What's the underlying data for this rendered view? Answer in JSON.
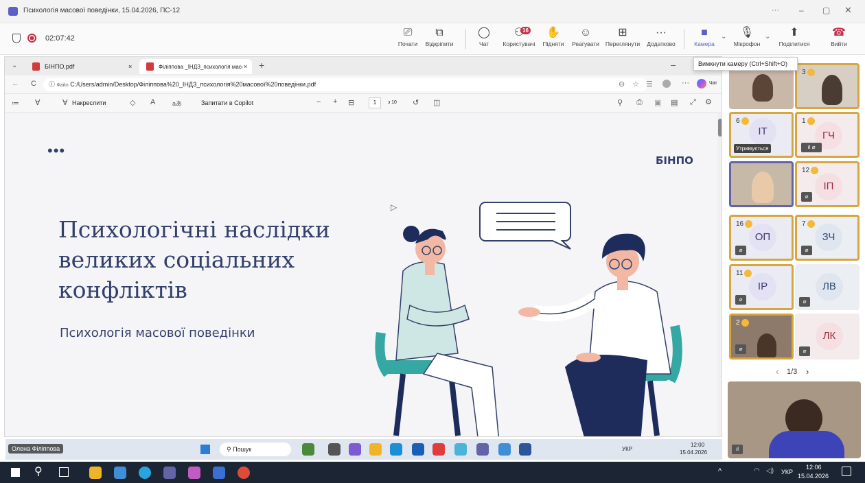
{
  "window": {
    "title": "Психологія масової поведінки, 15.04.2026, ПС-12",
    "controls": [
      "···",
      "–",
      "▢",
      "✕"
    ]
  },
  "meeting": {
    "timer": "02:07:42",
    "buttons": [
      {
        "id": "present",
        "label": "Почати",
        "icon": "present-icon"
      },
      {
        "id": "popout",
        "label": "Відкріпити",
        "icon": "popout-icon"
      },
      {
        "id": "chat",
        "label": "Чат",
        "icon": "chat-icon"
      },
      {
        "id": "people",
        "label": "Користувачі",
        "icon": "people-icon",
        "badge": "16"
      },
      {
        "id": "raise",
        "label": "Підняти",
        "icon": "raise-hand-icon"
      },
      {
        "id": "react",
        "label": "Реагувати",
        "icon": "react-icon"
      },
      {
        "id": "view",
        "label": "Переглянути",
        "icon": "view-icon"
      },
      {
        "id": "more",
        "label": "Додатково",
        "icon": "more-icon"
      },
      {
        "id": "camera",
        "label": "Камера",
        "icon": "camera-icon"
      },
      {
        "id": "mic",
        "label": "Мікрофон",
        "icon": "mic-off-icon"
      },
      {
        "id": "share",
        "label": "Поділитися",
        "icon": "share-icon"
      },
      {
        "id": "leave",
        "label": "Вийти",
        "icon": "leave-icon"
      }
    ],
    "tooltip": "Вимкнути камеру (Ctrl+Shift+O)",
    "pager": "1/3",
    "presenter_name": "Олена Філіппова"
  },
  "browser": {
    "tabs": [
      {
        "label": "БІНПО.pdf",
        "active": false
      },
      {
        "label": "Філіппова _ІНДЗ_психологія масо",
        "active": true
      }
    ],
    "address_prefix": "Файл",
    "address": "C:/Users/admin/Desktop/Філіппова%20_ІНДЗ_психологія%20масової%20поведінки.pdf",
    "chat_label": "Чат",
    "pdf": {
      "draw_label": "Накреслити",
      "copilot_label": "Запитати в Copilot",
      "page_current": "1",
      "page_total": "з 10"
    }
  },
  "slide": {
    "dots": "•••",
    "brand": "БІНПО",
    "title_lines": [
      "Психологічні наслідки",
      "великих соціальних",
      "конфліктів"
    ],
    "subtitle": "Психологія масової поведінки",
    "colors": {
      "title": "#33406b",
      "accent": "#35a8a4",
      "navy": "#1e2c5c"
    }
  },
  "participants": [
    {
      "initials": "",
      "hand": "",
      "video": true
    },
    {
      "initials": "",
      "hand": "3",
      "video": true
    },
    {
      "initials": "ІТ",
      "hand": "6",
      "status": "Утримується",
      "bg": "#e3e1f3"
    },
    {
      "initials": "ГЧ",
      "hand": "1",
      "bg": "#f5dfe3"
    },
    {
      "initials": "",
      "hand": "",
      "video": true
    },
    {
      "initials": "ІП",
      "hand": "12",
      "bg": "#f5dfe3"
    },
    {
      "initials": "ОП",
      "hand": "16",
      "bg": "#e3e1f3"
    },
    {
      "initials": "ЗЧ",
      "hand": "7",
      "bg": "#dfe6ef"
    },
    {
      "initials": "ІР",
      "hand": "11",
      "bg": "#e3e1f3"
    },
    {
      "initials": "ЛВ",
      "hand": "",
      "bg": "#dfe6ef"
    },
    {
      "initials": "",
      "hand": "2",
      "video": true
    },
    {
      "initials": "ЛК",
      "hand": "",
      "bg": "#f5dfe3"
    }
  ],
  "presenter_taskbar": {
    "search": "Пошук",
    "lang": "УКР",
    "time": "12:00",
    "date": "15.04.2026"
  },
  "taskbar": {
    "lang": "УКР",
    "time": "12:06",
    "date": "15.04.2026"
  }
}
